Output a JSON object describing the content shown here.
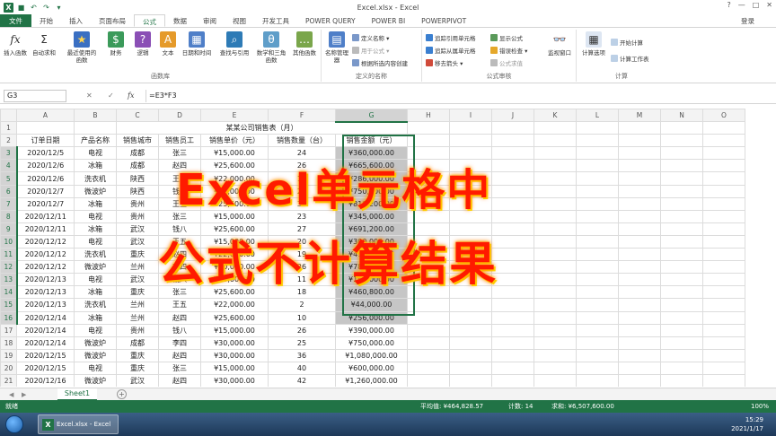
{
  "window": {
    "title": "Excel.xlsx - Excel",
    "minimize": "?",
    "restore": "—",
    "maximize": "□",
    "close": "✕"
  },
  "ribbon": {
    "tabs": [
      "文件",
      "开始",
      "插入",
      "页面布局",
      "公式",
      "数据",
      "审阅",
      "视图",
      "开发工具",
      "POWER QUERY",
      "POWER BI",
      "POWERPIVOT"
    ],
    "active_tab": "公式",
    "login": "登录",
    "groups": {
      "function_library": {
        "label": "函数库",
        "buttons": [
          "插入函数",
          "自动求和",
          "最近使用的函数",
          "财务",
          "逻辑",
          "文本",
          "日期和时间",
          "查找与引用",
          "数学和三角函数",
          "其他函数"
        ]
      },
      "defined_names": {
        "label": "定义的名称",
        "manager": "名称管理器",
        "items": [
          "定义名称",
          "用于公式",
          "根据所选内容创建"
        ]
      },
      "formula_auditing": {
        "label": "公式审核",
        "items": [
          "追踪引用单元格",
          "追踪从属单元格",
          "移去箭头",
          "显示公式",
          "错误检查",
          "公式求值"
        ],
        "watch": "监视窗口"
      },
      "calculation": {
        "label": "计算",
        "options": "计算选项",
        "items": [
          "开始计算",
          "计算工作表"
        ]
      }
    }
  },
  "formula_bar": {
    "name_box": "G3",
    "cancel": "✕",
    "enter": "✓",
    "fx": "fx",
    "formula": "=E3*F3"
  },
  "sheet": {
    "columns": [
      "A",
      "B",
      "C",
      "D",
      "E",
      "F",
      "G",
      "H",
      "I",
      "J",
      "K",
      "L",
      "M",
      "N",
      "O"
    ],
    "title": "某某公司销售表（月）",
    "headers": [
      "订单日期",
      "产品名称",
      "销售城市",
      "销售员工",
      "销售单价（元）",
      "销售数量（台）",
      "销售金额（元）"
    ],
    "rows": [
      {
        "n": "3",
        "date": "2020/12/5",
        "product": "电视",
        "city": "成都",
        "staff": "张三",
        "price": "¥15,000.00",
        "qty": "24",
        "amount": "¥360,000.00"
      },
      {
        "n": "4",
        "date": "2020/12/6",
        "product": "冰箱",
        "city": "成都",
        "staff": "赵四",
        "price": "¥25,600.00",
        "qty": "26",
        "amount": "¥665,600.00"
      },
      {
        "n": "5",
        "date": "2020/12/6",
        "product": "洗衣机",
        "city": "陕西",
        "staff": "王五",
        "price": "¥22,000.00",
        "qty": "13",
        "amount": "¥286,000.00"
      },
      {
        "n": "6",
        "date": "2020/12/7",
        "product": "微波炉",
        "city": "陕西",
        "staff": "钱八",
        "price": "¥30,000.00",
        "qty": "25",
        "amount": "¥750,000.00"
      },
      {
        "n": "7",
        "date": "2020/12/7",
        "product": "冰箱",
        "city": "贵州",
        "staff": "王五",
        "price": "¥25,600.00",
        "qty": "32",
        "amount": "¥819,200.00"
      },
      {
        "n": "8",
        "date": "2020/12/11",
        "product": "电视",
        "city": "贵州",
        "staff": "张三",
        "price": "¥15,000.00",
        "qty": "23",
        "amount": "¥345,000.00"
      },
      {
        "n": "9",
        "date": "2020/12/11",
        "product": "冰箱",
        "city": "武汉",
        "staff": "钱八",
        "price": "¥25,600.00",
        "qty": "27",
        "amount": "¥691,200.00"
      },
      {
        "n": "10",
        "date": "2020/12/12",
        "product": "电视",
        "city": "武汉",
        "staff": "王五",
        "price": "¥15,000.00",
        "qty": "20",
        "amount": "¥300,000.00"
      },
      {
        "n": "11",
        "date": "2020/12/12",
        "product": "洗衣机",
        "city": "重庆",
        "staff": "赵四",
        "price": "¥22,000.00",
        "qty": "19",
        "amount": "¥418,000.00"
      },
      {
        "n": "12",
        "date": "2020/12/12",
        "product": "微波炉",
        "city": "兰州",
        "staff": "李四",
        "price": "¥30,000.00",
        "qty": "26",
        "amount": "¥780,000.00"
      },
      {
        "n": "13",
        "date": "2020/12/13",
        "product": "电视",
        "city": "武汉",
        "staff": "钱八",
        "price": "¥15,000.00",
        "qty": "11",
        "amount": "¥165,000.00"
      },
      {
        "n": "14",
        "date": "2020/12/13",
        "product": "冰箱",
        "city": "重庆",
        "staff": "张三",
        "price": "¥25,600.00",
        "qty": "18",
        "amount": "¥460,800.00"
      },
      {
        "n": "15",
        "date": "2020/12/13",
        "product": "洗衣机",
        "city": "兰州",
        "staff": "王五",
        "price": "¥22,000.00",
        "qty": "2",
        "amount": "¥44,000.00"
      },
      {
        "n": "16",
        "date": "2020/12/14",
        "product": "冰箱",
        "city": "兰州",
        "staff": "赵四",
        "price": "¥25,600.00",
        "qty": "10",
        "amount": "¥256,000.00"
      },
      {
        "n": "17",
        "date": "2020/12/14",
        "product": "电视",
        "city": "贵州",
        "staff": "钱八",
        "price": "¥15,000.00",
        "qty": "26",
        "amount": "¥390,000.00"
      },
      {
        "n": "18",
        "date": "2020/12/14",
        "product": "微波炉",
        "city": "成都",
        "staff": "李四",
        "price": "¥30,000.00",
        "qty": "25",
        "amount": "¥750,000.00"
      },
      {
        "n": "19",
        "date": "2020/12/15",
        "product": "微波炉",
        "city": "重庆",
        "staff": "赵四",
        "price": "¥30,000.00",
        "qty": "36",
        "amount": "¥1,080,000.00"
      },
      {
        "n": "20",
        "date": "2020/12/15",
        "product": "电视",
        "city": "重庆",
        "staff": "张三",
        "price": "¥15,000.00",
        "qty": "40",
        "amount": "¥600,000.00"
      },
      {
        "n": "21",
        "date": "2020/12/16",
        "product": "微波炉",
        "city": "武汉",
        "staff": "赵四",
        "price": "¥30,000.00",
        "qty": "42",
        "amount": "¥1,260,000.00"
      }
    ],
    "tab_name": "Sheet1"
  },
  "overlay": {
    "line1": "Excel单元格中",
    "line2": "公式不计算结果",
    "color": "#ff1a00"
  },
  "statusbar": {
    "ready": "就绪",
    "average": "平均值: ¥464,828.57",
    "count": "计数: 14",
    "sum": "求和: ¥6,507,600.00",
    "zoom": "100%"
  },
  "taskbar": {
    "excel_label": "Excel.xlsx - Excel",
    "time": "15:29",
    "date": "2021/1/17"
  },
  "colors": {
    "brand": "#217346",
    "selection": "#c6c6c6"
  }
}
